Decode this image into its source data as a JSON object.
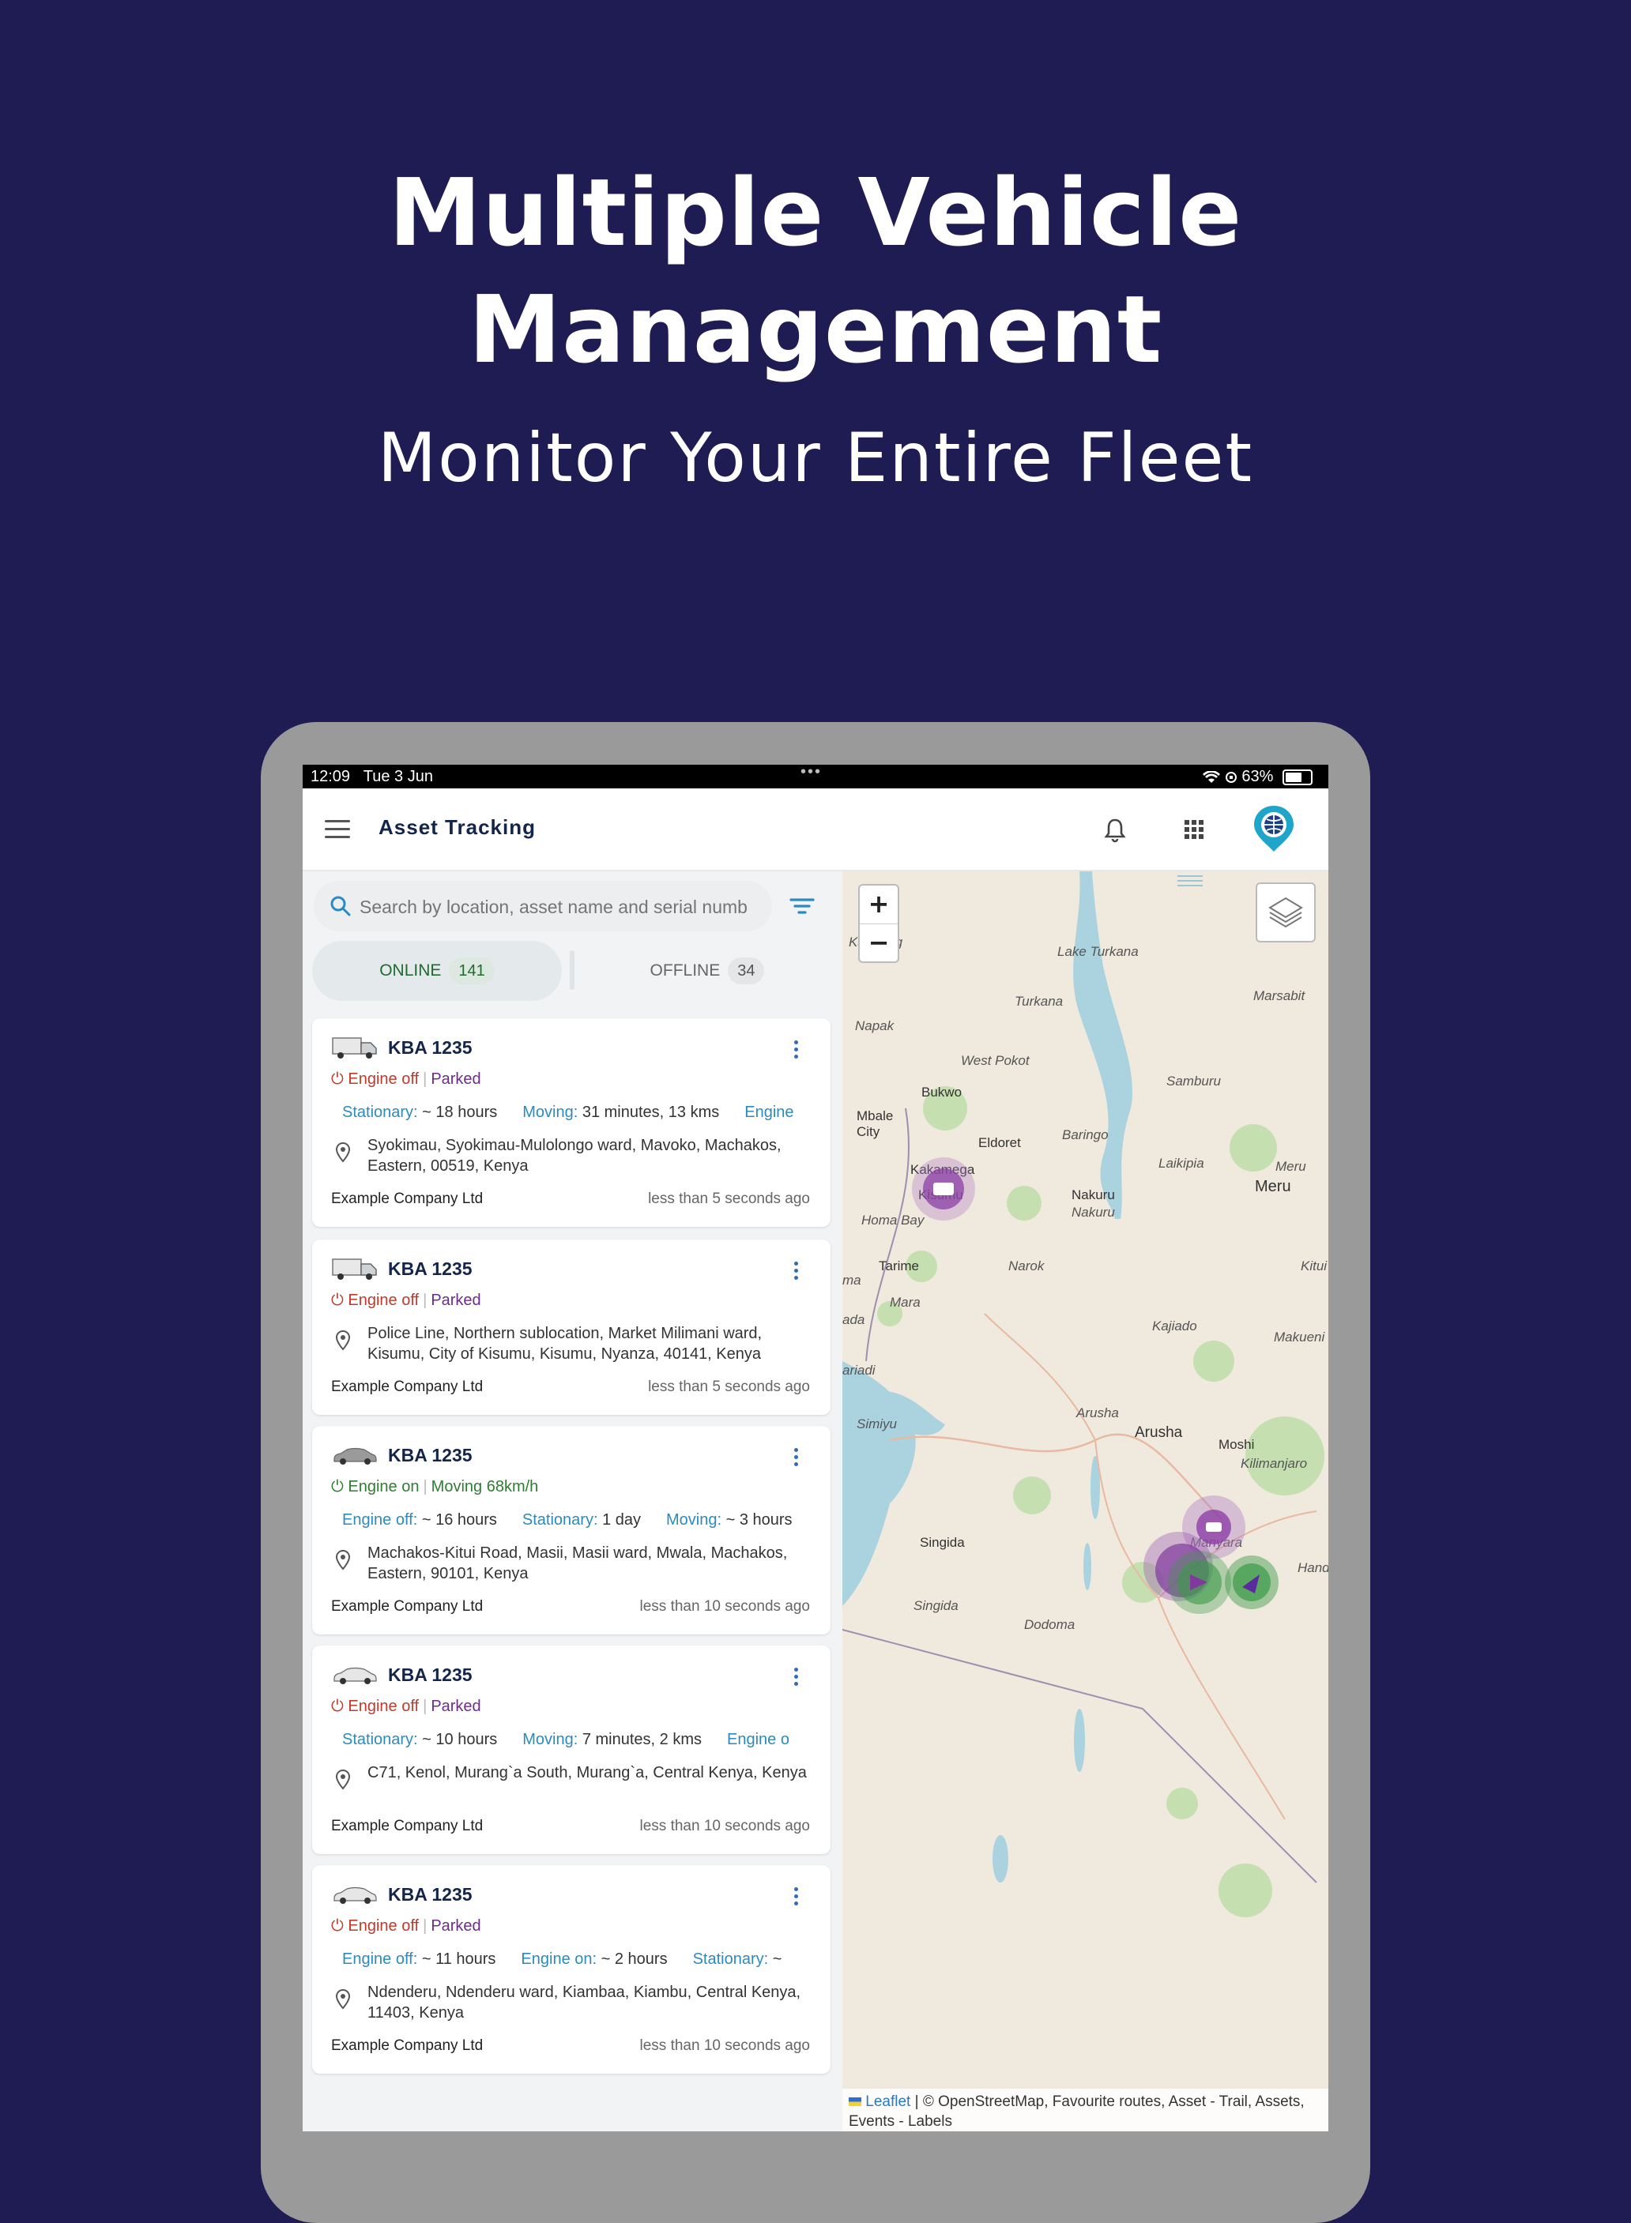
{
  "hero": {
    "title_line1": "Multiple Vehicle",
    "title_line2": "Management",
    "subtitle": "Monitor Your Entire Fleet"
  },
  "statusbar": {
    "time": "12:09",
    "date": "Tue 3 Jun",
    "battery": "63%"
  },
  "appbar": {
    "title": "Asset Tracking",
    "icons": [
      "menu-icon",
      "bell-icon",
      "apps-grid-icon",
      "globe-pin-logo-icon"
    ]
  },
  "search": {
    "placeholder": "Search by location, asset name and serial numb"
  },
  "tabs": {
    "online": {
      "label": "ONLINE",
      "count": "141"
    },
    "offline": {
      "label": "OFFLINE",
      "count": "34"
    }
  },
  "cards": [
    {
      "plate": "KBA 1235",
      "vehicle": "truck",
      "engine": "Engine off",
      "state": "Parked",
      "stats": [
        {
          "k": "Stationary:",
          "v": "~ 18 hours"
        },
        {
          "k": "Moving:",
          "v": "31 minutes, 13 kms"
        },
        {
          "k": "Engine",
          "v": ""
        }
      ],
      "address": "Syokimau, Syokimau-Mulolongo ward, Mavoko, Machakos, Eastern, 00519, Kenya",
      "company": "Example Company Ltd",
      "ago": "less than 5 seconds ago"
    },
    {
      "plate": "KBA 1235",
      "vehicle": "truck",
      "engine": "Engine off",
      "state": "Parked",
      "stats": [],
      "address": "Police Line, Northern sublocation, Market Milimani ward, Kisumu, City of Kisumu, Kisumu, Nyanza, 40141, Kenya",
      "company": "Example Company Ltd",
      "ago": "less than 5 seconds ago"
    },
    {
      "plate": "KBA 1235",
      "vehicle": "car",
      "engine": "Engine on",
      "state": "Moving 68km/h",
      "stats": [
        {
          "k": "Engine off:",
          "v": "~ 16 hours"
        },
        {
          "k": "Stationary:",
          "v": "1 day"
        },
        {
          "k": "Moving:",
          "v": "~ 3 hours"
        }
      ],
      "address": "Machakos-Kitui Road, Masii, Masii ward, Mwala, Machakos, Eastern, 90101, Kenya",
      "company": "Example Company Ltd",
      "ago": "less than 10 seconds ago"
    },
    {
      "plate": "KBA 1235",
      "vehicle": "car",
      "engine": "Engine off",
      "state": "Parked",
      "stats": [
        {
          "k": "Stationary:",
          "v": "~ 10 hours"
        },
        {
          "k": "Moving:",
          "v": "7 minutes, 2 kms"
        },
        {
          "k": "Engine o",
          "v": ""
        }
      ],
      "address": "C71, Kenol, Murang`a South, Murang`a, Central Kenya, Kenya",
      "company": "Example Company Ltd",
      "ago": "less than 10 seconds ago"
    },
    {
      "plate": "KBA 1235",
      "vehicle": "car",
      "engine": "Engine off",
      "state": "Parked",
      "stats": [
        {
          "k": "Engine off:",
          "v": "~ 11 hours"
        },
        {
          "k": "Engine on:",
          "v": "~ 2 hours"
        },
        {
          "k": "Stationary:",
          "v": "~"
        }
      ],
      "address": "Ndenderu, Ndenderu ward, Kiambaa, Kiambu, Central Kenya, 11403, Kenya",
      "company": "Example Company Ltd",
      "ago": "less than 10 seconds ago"
    }
  ],
  "map": {
    "zoom_in": "+",
    "zoom_out": "−",
    "attribution_link": "Leaflet",
    "attribution_rest": " | © OpenStreetMap, Favourite routes, Asset - Trail, Assets, Events - Labels",
    "labels": [
      "Kaabong",
      "Lake Turkana",
      "Marsabit",
      "Turkana",
      "Napak",
      "West Pokot",
      "Samburu",
      "Bukwo",
      "Mbale City",
      "Eldoret",
      "Baringo",
      "Laikipia",
      "Meru",
      "Meru",
      "Kakamega",
      "Kisumu",
      "Nakuru",
      "Nakuru",
      "Homa Bay",
      "Tarime",
      "Narok",
      "Kitui",
      "Mara",
      "Kajiado",
      "Makueni",
      "Arusha",
      "Arusha",
      "Moshi",
      "Kilimanjaro",
      "Simiyu",
      "Singida",
      "Manyara",
      "Singida",
      "Dodoma",
      "Hande",
      "ariadi",
      "ada",
      "ma"
    ]
  }
}
